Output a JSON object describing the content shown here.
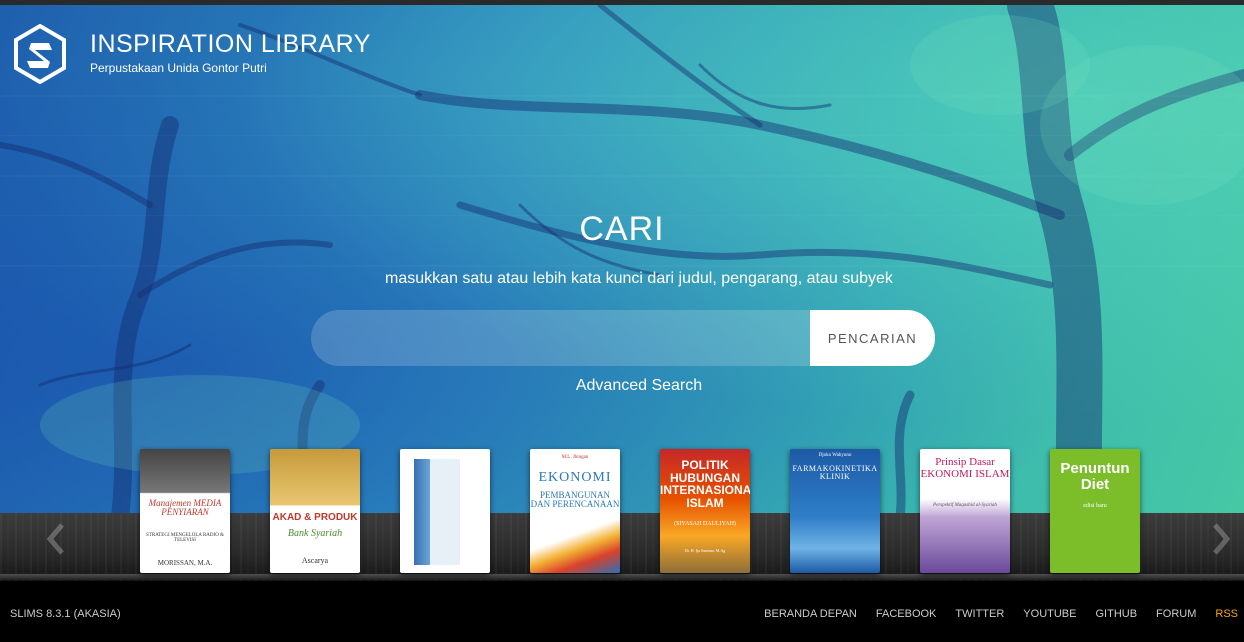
{
  "header": {
    "title": "INSPIRATION LIBRARY",
    "subtitle": "Perpustakaan Unida Gontor Putri"
  },
  "search": {
    "heading": "CARI",
    "hint": "masukkan satu atau lebih kata kunci dari judul, pengarang, atau subyek",
    "placeholder": "",
    "button_label": "PENCARIAN",
    "advanced_label": "Advanced Search"
  },
  "books": [
    {
      "title": "Manajemen MEDIA PENYIARAN",
      "subtitle": "STRATEGI MENGELOLA RADIO & TELEVISI",
      "author": "MORISSAN, M.A."
    },
    {
      "title": "AKAD & PRODUK",
      "subtitle": "Bank Syariah",
      "author": "Ascarya"
    },
    {
      "title": "",
      "subtitle": "",
      "author": ""
    },
    {
      "title": "EKONOMI",
      "subtitle": "PEMBANGUNAN DAN PERENCANAAN",
      "author": "M.L. Jhingan"
    },
    {
      "title": "POLITIK HUBUNGAN INTERNASIONAL ISLAM",
      "subtitle": "(SIYASAH DAULIYAH)",
      "author": "Dr. H. Ija Suntana, M.Ag"
    },
    {
      "title": "FARMAKOKINETIKA KLINIK",
      "subtitle": "",
      "author": "Djoko Wahyono"
    },
    {
      "title": "Prinsip Dasar EKONOMI ISLAM",
      "subtitle": "Perspektif Maqashid al-Syariah",
      "author": ""
    },
    {
      "title": "Penuntun Diet",
      "subtitle": "edisi baru",
      "author": ""
    }
  ],
  "footer": {
    "version": "SLIMS 8.3.1 (AKASIA)",
    "nav": [
      "BERANDA DEPAN",
      "FACEBOOK",
      "TWITTER",
      "YOUTUBE",
      "GITHUB",
      "FORUM",
      "RSS"
    ]
  },
  "icons": {
    "logo": "slims-logo-icon",
    "prev": "chevron-left-icon",
    "next": "chevron-right-icon"
  },
  "colors": {
    "rss": "#f5a623",
    "hero_blue": "#1e5fae",
    "hero_teal": "#46c8a5"
  }
}
